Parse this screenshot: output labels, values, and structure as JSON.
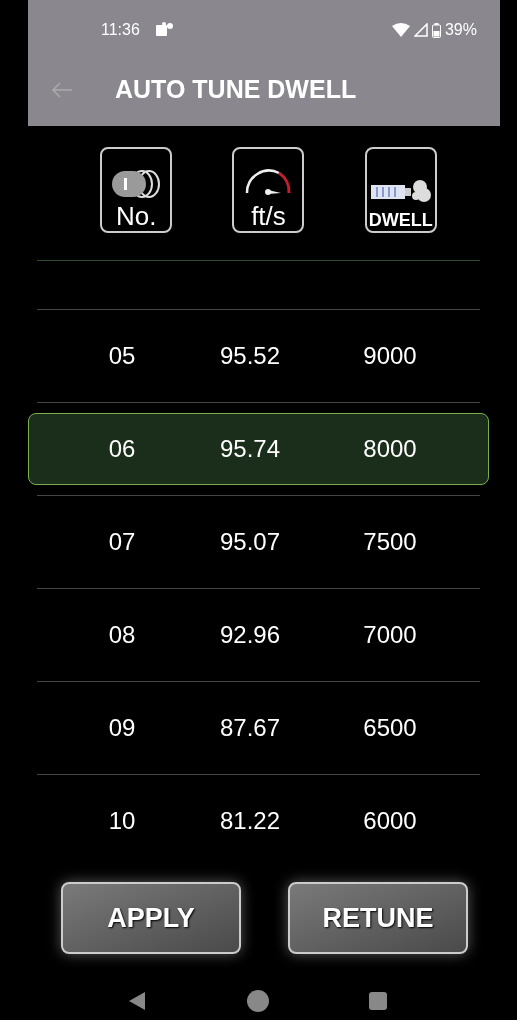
{
  "status_bar": {
    "time": "11:36",
    "battery": "39%"
  },
  "app_bar": {
    "title": "AUTO TUNE DWELL"
  },
  "columns": [
    {
      "kind": "number",
      "label": "No."
    },
    {
      "kind": "speed",
      "label": "ft/s"
    },
    {
      "kind": "dwell",
      "label": "DWELL"
    }
  ],
  "rows": [
    {
      "cells": [
        "05",
        "95.52",
        "9000"
      ],
      "selected": false
    },
    {
      "cells": [
        "06",
        "95.74",
        "8000"
      ],
      "selected": true
    },
    {
      "cells": [
        "07",
        "95.07",
        "7500"
      ],
      "selected": false
    },
    {
      "cells": [
        "08",
        "92.96",
        "7000"
      ],
      "selected": false
    },
    {
      "cells": [
        "09",
        "87.67",
        "6500"
      ],
      "selected": false
    },
    {
      "cells": [
        "10",
        "81.22",
        "6000"
      ],
      "selected": false
    }
  ],
  "buttons": [
    "APPLY",
    "RETUNE"
  ]
}
